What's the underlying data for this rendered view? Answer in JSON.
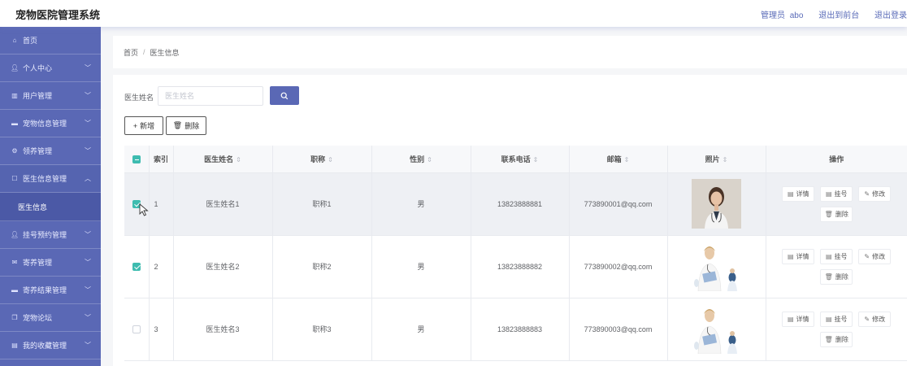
{
  "header": {
    "title": "宠物医院管理系统",
    "admin_role": "管理员",
    "admin_name": "abo",
    "front_link": "退出到前台",
    "logout_link": "退出登录"
  },
  "sidebar": {
    "items": [
      {
        "label": "首页",
        "icon": "home-icon",
        "has_arrow": false
      },
      {
        "label": "个人中心",
        "icon": "user-icon",
        "has_arrow": true
      },
      {
        "label": "用户管理",
        "icon": "trash-icon",
        "has_arrow": true
      },
      {
        "label": "宠物信息管理",
        "icon": "message-icon",
        "has_arrow": true
      },
      {
        "label": "领养管理",
        "icon": "settings-icon",
        "has_arrow": true
      },
      {
        "label": "医生信息管理",
        "icon": "menu-icon",
        "has_arrow": true,
        "expanded": true
      },
      {
        "label": "挂号预约管理",
        "icon": "user-icon",
        "has_arrow": true
      },
      {
        "label": "寄养管理",
        "icon": "mail-icon",
        "has_arrow": true
      },
      {
        "label": "寄养结果管理",
        "icon": "message-icon",
        "has_arrow": true
      },
      {
        "label": "宠物论坛",
        "icon": "copy-icon",
        "has_arrow": true
      },
      {
        "label": "我的收藏管理",
        "icon": "document-icon",
        "has_arrow": true
      }
    ],
    "submenu_active": "医生信息"
  },
  "breadcrumb": {
    "home": "首页",
    "current": "医生信息"
  },
  "search": {
    "label": "医生姓名",
    "placeholder": "医生姓名",
    "value": ""
  },
  "toolbar": {
    "add_label": "新增",
    "delete_label": "删除"
  },
  "table": {
    "columns": [
      "索引",
      "医生姓名",
      "职称",
      "性别",
      "联系电话",
      "邮箱",
      "照片",
      "操作"
    ],
    "rows": [
      {
        "index": "1",
        "name": "医生姓名1",
        "title": "职称1",
        "gender": "男",
        "phone": "13823888881",
        "email": "773890001@qq.com",
        "checked": true
      },
      {
        "index": "2",
        "name": "医生姓名2",
        "title": "职称2",
        "gender": "男",
        "phone": "13823888882",
        "email": "773890002@qq.com",
        "checked": true
      },
      {
        "index": "3",
        "name": "医生姓名3",
        "title": "职称3",
        "gender": "男",
        "phone": "13823888883",
        "email": "773890003@qq.com",
        "checked": false
      }
    ],
    "actions": {
      "detail": "详情",
      "register": "挂号",
      "edit": "修改",
      "delete": "删除"
    }
  },
  "colors": {
    "accent": "#5a68b5",
    "check": "#3ebcb0"
  }
}
